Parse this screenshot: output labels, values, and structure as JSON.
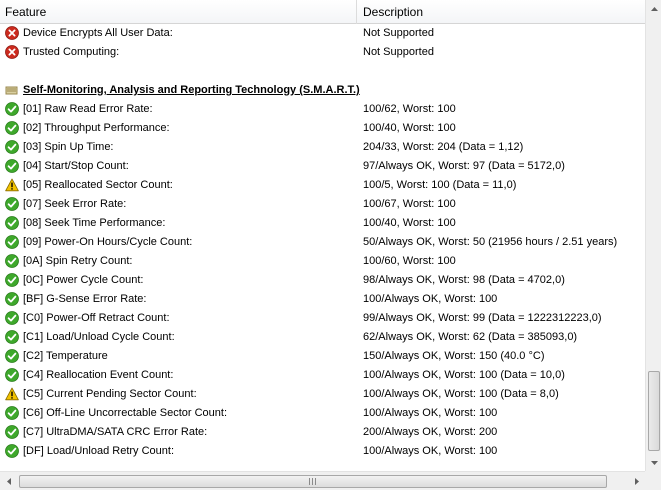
{
  "header": {
    "feature": "Feature",
    "description": "Description"
  },
  "top_rows": [
    {
      "icon": "red-x",
      "feature": "Device Encrypts All User Data:",
      "value": "Not Supported"
    },
    {
      "icon": "red-x",
      "feature": "Trusted Computing:",
      "value": "Not Supported"
    }
  ],
  "section": {
    "icon": "drive",
    "title": "Self-Monitoring, Analysis and Reporting Technology (S.M.A.R.T.)"
  },
  "smart": [
    {
      "icon": "ok",
      "feature": "[01] Raw Read Error Rate:",
      "value": "100/62, Worst: 100"
    },
    {
      "icon": "ok",
      "feature": "[02] Throughput Performance:",
      "value": "100/40, Worst: 100"
    },
    {
      "icon": "ok",
      "feature": "[03] Spin Up Time:",
      "value": "204/33, Worst: 204 (Data = 1,12)"
    },
    {
      "icon": "ok",
      "feature": "[04] Start/Stop Count:",
      "value": "97/Always OK, Worst: 97 (Data = 5172,0)"
    },
    {
      "icon": "warn",
      "feature": "[05] Reallocated Sector Count:",
      "value": "100/5, Worst: 100 (Data = 11,0)"
    },
    {
      "icon": "ok",
      "feature": "[07] Seek Error Rate:",
      "value": "100/67, Worst: 100"
    },
    {
      "icon": "ok",
      "feature": "[08] Seek Time Performance:",
      "value": "100/40, Worst: 100"
    },
    {
      "icon": "ok",
      "feature": "[09] Power-On Hours/Cycle Count:",
      "value": "50/Always OK, Worst: 50 (21956 hours / 2.51 years)"
    },
    {
      "icon": "ok",
      "feature": "[0A] Spin Retry Count:",
      "value": "100/60, Worst: 100"
    },
    {
      "icon": "ok",
      "feature": "[0C] Power Cycle Count:",
      "value": "98/Always OK, Worst: 98 (Data = 4702,0)"
    },
    {
      "icon": "ok",
      "feature": "[BF] G-Sense Error Rate:",
      "value": "100/Always OK, Worst: 100"
    },
    {
      "icon": "ok",
      "feature": "[C0] Power-Off Retract Count:",
      "value": "99/Always OK, Worst: 99 (Data = 1222312223,0)"
    },
    {
      "icon": "ok",
      "feature": "[C1] Load/Unload Cycle Count:",
      "value": "62/Always OK, Worst: 62 (Data = 385093,0)"
    },
    {
      "icon": "ok",
      "feature": "[C2] Temperature",
      "value": "150/Always OK, Worst: 150 (40.0 °C)"
    },
    {
      "icon": "ok",
      "feature": "[C4] Reallocation Event Count:",
      "value": "100/Always OK, Worst: 100 (Data = 10,0)"
    },
    {
      "icon": "warn",
      "feature": "[C5] Current Pending Sector Count:",
      "value": "100/Always OK, Worst: 100 (Data = 8,0)"
    },
    {
      "icon": "ok",
      "feature": "[C6] Off-Line Uncorrectable Sector Count:",
      "value": "100/Always OK, Worst: 100"
    },
    {
      "icon": "ok",
      "feature": "[C7] UltraDMA/SATA CRC Error Rate:",
      "value": "200/Always OK, Worst: 200"
    },
    {
      "icon": "ok",
      "feature": "[DF] Load/Unload Retry Count:",
      "value": "100/Always OK, Worst: 100"
    }
  ],
  "colors": {
    "ok": "#3ea82b",
    "error": "#cc2a1e",
    "warning": "#f2c200"
  }
}
